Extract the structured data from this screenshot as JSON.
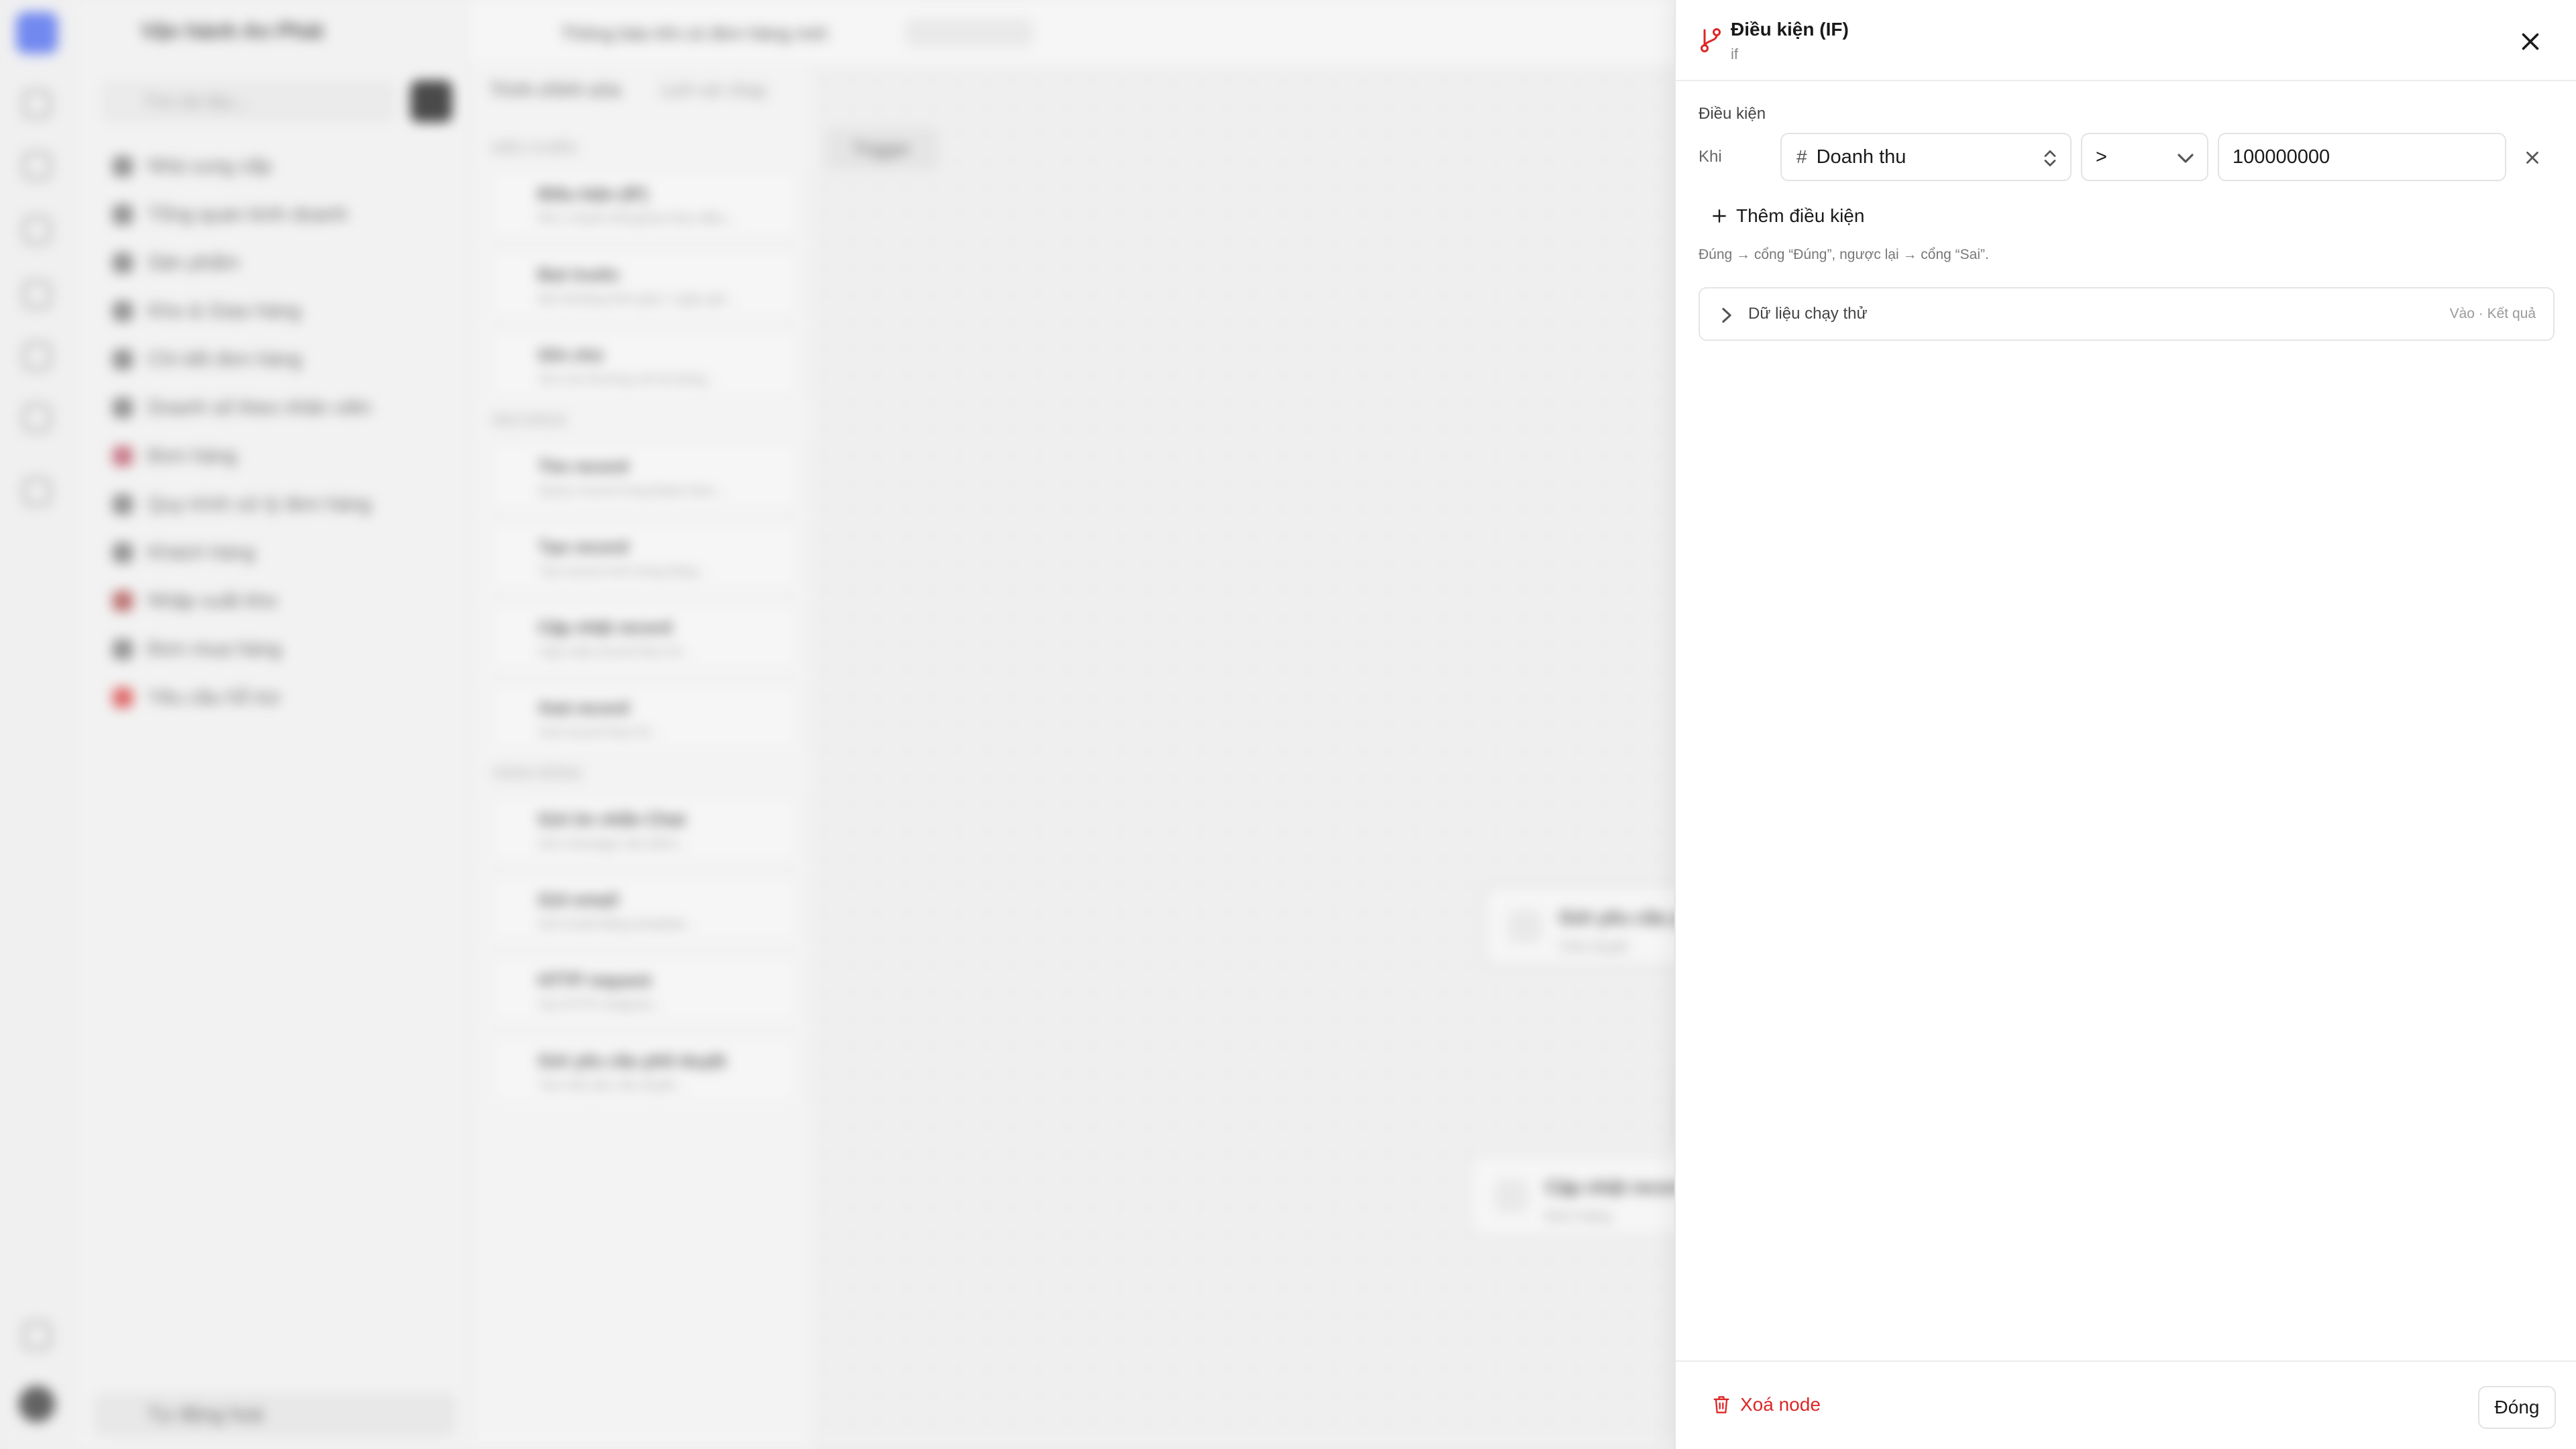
{
  "background": {
    "sidebar_title": "Vận hành An Phát",
    "search_placeholder": "Tìm tài liệu...",
    "sidebar_items": [
      "Nhà cung cấp",
      "Tổng quan kinh doanh",
      "Sản phẩm",
      "Kho & Giao hàng",
      "Chi tiết đơn hàng",
      "Doanh số theo nhân viên",
      "Đơn hàng",
      "Quy trình xử lý đơn hàng",
      "Khách hàng",
      "Nhập xuất kho",
      "Đơn mua hàng",
      "Yêu cầu hỗ trợ"
    ],
    "sidebar_bottom": "Tự động hoá",
    "workflow_title": "Thông báo khi có đơn hàng mới",
    "tabs": [
      "Trình chỉnh sửa",
      "Lịch sử chạy"
    ],
    "palette_sections": [
      {
        "title": "ĐIỀU KHIỂN",
        "items": [
          {
            "title": "Điều kiện (IF)",
            "desc": "Rẽ 2 nhánh Đúng/Sai theo điều..."
          },
          {
            "title": "Đợi trước",
            "desc": "Đợi khoảng thời gian / ngày giờ..."
          },
          {
            "title": "Ghi chú",
            "desc": "Ghi chú thường mô tả luồng..."
          }
        ]
      },
      {
        "title": "RECORDS",
        "items": [
          {
            "title": "Tìm record",
            "desc": "Query record trong Base theo..."
          },
          {
            "title": "Tạo record",
            "desc": "Tạo record mới trong bảng..."
          },
          {
            "title": "Cập nhật record",
            "desc": "Cập nhật record theo ID..."
          },
          {
            "title": "Xoá record",
            "desc": "Xoá record theo ID..."
          }
        ]
      },
      {
        "title": "HÀNH ĐỘNG",
        "items": [
          {
            "title": "Gửi tin nhắn Chat",
            "desc": "Gửi message vào kênh..."
          },
          {
            "title": "Gửi email",
            "desc": "Gửi email bằng template..."
          },
          {
            "title": "HTTP request",
            "desc": "Gọi HTTP endpoint..."
          },
          {
            "title": "Gửi yêu cầu phê duyệt",
            "desc": "Tạo một yêu cầu duyệt..."
          }
        ]
      }
    ],
    "trigger_label": "Trigger",
    "nodes": [
      {
        "title": "Gửi yêu cầu phê duyệt",
        "desc": "Chờ duyệt"
      },
      {
        "title": "Cập nhật record",
        "desc": "Đơn hàng"
      }
    ]
  },
  "panel": {
    "title": "Điều kiện (IF)",
    "subtitle": "if",
    "section_label": "Điều kiện",
    "row_label": "Khi",
    "condition": {
      "variable_icon": "#",
      "variable": "Doanh thu",
      "operator": ">",
      "value": "100000000"
    },
    "add_condition": "Thêm điều kiện",
    "hint": "Đúng → cổng “Đúng”, ngược lại → cổng “Sai”.",
    "test_data": {
      "label": "Dữ liệu chạy thử",
      "meta": "Vào · Kết quả"
    },
    "delete_node": "Xoá node",
    "close_button": "Đóng",
    "accent_red": "#dc2626"
  }
}
